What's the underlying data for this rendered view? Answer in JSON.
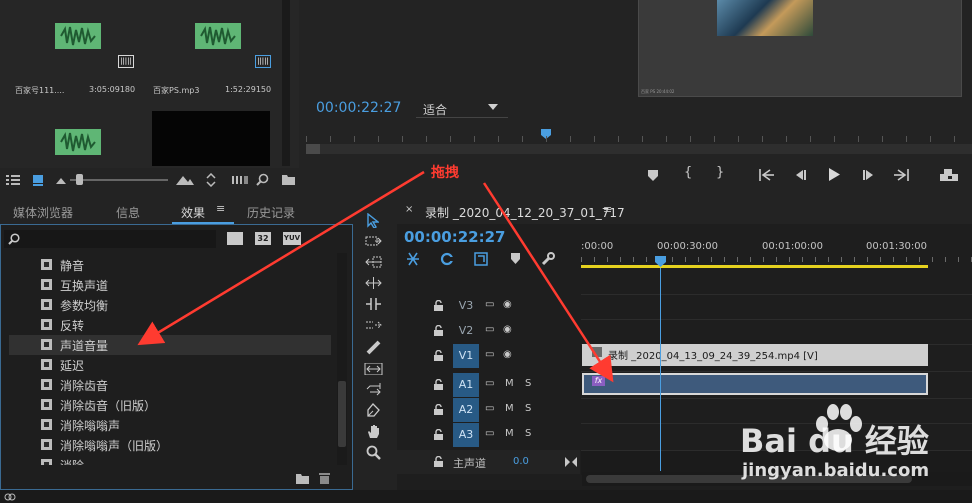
{
  "project_bin": {
    "items": [
      {
        "name": "百家号111....",
        "duration": "3:05:09180",
        "badge": "|||||"
      },
      {
        "name": "百家PS.mp3",
        "duration": "1:52:29150",
        "badge": "|||||"
      }
    ]
  },
  "program_monitor": {
    "timecode": "00:00:22:27",
    "fit_select": "适合",
    "fit_options": [
      "适合"
    ],
    "preview_footer": "百家 PS 20:44:02"
  },
  "left_tabs": [
    {
      "label": "媒体浏览器",
      "active": false
    },
    {
      "label": "信息",
      "active": false
    },
    {
      "label": "效果",
      "active": true
    },
    {
      "label": "历史记录",
      "active": false
    }
  ],
  "effects_panel": {
    "search_value": "",
    "tool_buttons": [
      "32",
      "YUV"
    ],
    "items": [
      "静音",
      "互换声道",
      "参数均衡",
      "反转",
      "声道音量",
      "延迟",
      "消除齿音",
      "消除齿音（旧版）",
      "消除嗡嗡声",
      "消除嗡嗡声（旧版）",
      "消除..."
    ],
    "selected_index": 4
  },
  "annotation": {
    "label": "拖拽",
    "color": "#ff3b30"
  },
  "timeline": {
    "sequence_name": "录制 _2020_04_12_20_37_01_717",
    "timecode": "00:00:22:27",
    "ruler_labels": [
      ":00:00",
      "00:00:30:00",
      "00:01:00:00",
      "00:01:30:00"
    ],
    "tracks": [
      {
        "name": "V3",
        "type": "video",
        "targeted": false
      },
      {
        "name": "V2",
        "type": "video",
        "targeted": false
      },
      {
        "name": "V1",
        "type": "video",
        "targeted": true
      },
      {
        "name": "A1",
        "type": "audio",
        "targeted": true
      },
      {
        "name": "A2",
        "type": "audio",
        "targeted": true
      },
      {
        "name": "A3",
        "type": "audio",
        "targeted": true
      }
    ],
    "track_m": "M",
    "track_s": "S",
    "master": {
      "label": "主声道",
      "value": "0.0"
    },
    "video_clip": "录制 _2020_04_13_09_24_39_254.mp4 [V]",
    "fx_badge": "fx"
  },
  "watermark": {
    "brand": "Bai du 经验",
    "url": "jingyan.baidu.com"
  },
  "colors": {
    "accent_blue": "#4a9ee0",
    "audio_thumb": "#5fb675",
    "audio_clip": "#3e5a7c",
    "track_target": "#285a85",
    "work_area": "#e6d21f"
  }
}
